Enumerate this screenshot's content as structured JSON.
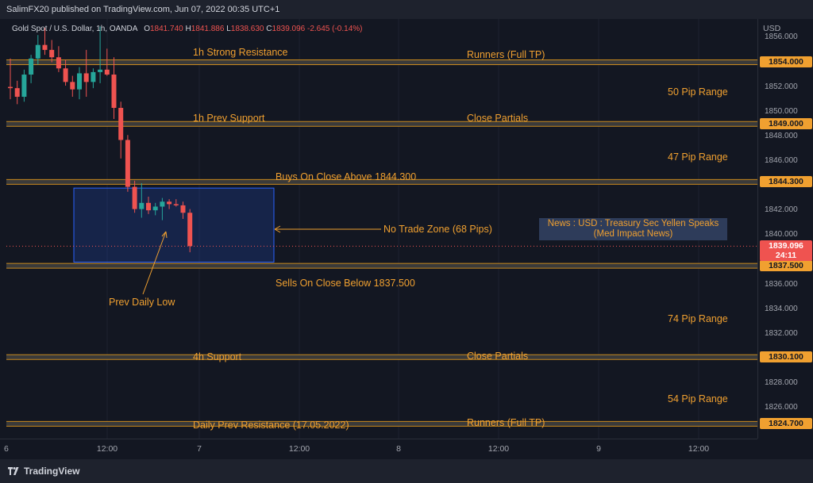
{
  "header": {
    "published_text": "SalimFX20 published on TradingView.com, Jun 07, 2022 00:35 UTC+1"
  },
  "legend": {
    "symbol": "Gold Spot / U.S. Dollar, 1h, OANDA",
    "open_label": "O",
    "open": "1841.740",
    "high_label": "H",
    "high": "1841.886",
    "low_label": "L",
    "low": "1838.630",
    "close_label": "C",
    "close": "1839.096",
    "change": "-2.645 (-0.14%)"
  },
  "annotations": {
    "strong_resistance": "1h Strong Resistance",
    "runners_top": "Runners (Full TP)",
    "range_50": "50 Pip Range",
    "prev_support": "1h Prev Support",
    "close_partials_top": "Close Partials",
    "range_47": "47 Pip Range",
    "buys_above": "Buys On Close Above 1844.300",
    "no_trade_zone": "No Trade Zone (68 Pips)",
    "news_line1": "News : USD : Treasury Sec Yellen Speaks",
    "news_line2": "(Med Impact News)",
    "sells_below": "Sells On Close Below 1837.500",
    "prev_daily_low": "Prev Daily Low",
    "range_74": "74 Pip Range",
    "support_4h": "4h Support",
    "close_partials_bottom": "Close Partials",
    "range_54": "54 Pip Range",
    "daily_prev_resistance": "Daily Prev Resistance (17.05.2022)",
    "runners_bottom": "Runners (Full TP)"
  },
  "price_axis": {
    "currency": "USD",
    "ticks": [
      "1856.000",
      "1852.000",
      "1850.000",
      "1848.000",
      "1846.000",
      "1842.000",
      "1840.000",
      "1836.000",
      "1834.000",
      "1832.000",
      "1828.000",
      "1826.000"
    ],
    "levels": [
      "1854.000",
      "1849.000",
      "1844.300",
      "1837.500",
      "1830.100",
      "1824.700"
    ],
    "current_price": "1839.096",
    "countdown": "24:11"
  },
  "time_axis": {
    "ticks": [
      "6",
      "12:00",
      "7",
      "12:00",
      "8",
      "12:00",
      "9",
      "12:00"
    ]
  },
  "footer": {
    "brand": "TradingView"
  },
  "colors": {
    "background": "#131722",
    "level": "#f0a030",
    "up": "#26a69a",
    "down": "#ef5350",
    "zone": "#2962ff"
  },
  "chart_data": {
    "type": "candlestick",
    "symbol": "Gold Spot / U.S. Dollar",
    "timeframe": "1h",
    "ylim": [
      1823.5,
      1857.5
    ],
    "level_lines": [
      1854.0,
      1849.0,
      1844.3,
      1837.5,
      1830.1,
      1824.7
    ],
    "current_price": 1839.096,
    "no_trade_zone": {
      "top": 1843.8,
      "bottom": 1837.8
    },
    "candles": [
      {
        "o": 1852.0,
        "h": 1854.3,
        "l": 1851.0,
        "c": 1851.9
      },
      {
        "o": 1851.9,
        "h": 1852.5,
        "l": 1850.6,
        "c": 1851.2
      },
      {
        "o": 1851.2,
        "h": 1853.4,
        "l": 1850.8,
        "c": 1853.0
      },
      {
        "o": 1853.0,
        "h": 1854.6,
        "l": 1852.3,
        "c": 1854.3
      },
      {
        "o": 1854.3,
        "h": 1856.2,
        "l": 1853.8,
        "c": 1855.4
      },
      {
        "o": 1855.4,
        "h": 1856.8,
        "l": 1854.6,
        "c": 1855.0
      },
      {
        "o": 1855.0,
        "h": 1855.8,
        "l": 1854.0,
        "c": 1854.4
      },
      {
        "o": 1854.4,
        "h": 1855.3,
        "l": 1853.2,
        "c": 1853.5
      },
      {
        "o": 1853.5,
        "h": 1854.2,
        "l": 1852.1,
        "c": 1852.4
      },
      {
        "o": 1852.4,
        "h": 1852.9,
        "l": 1851.2,
        "c": 1851.8
      },
      {
        "o": 1851.8,
        "h": 1853.6,
        "l": 1851.0,
        "c": 1853.1
      },
      {
        "o": 1853.1,
        "h": 1855.0,
        "l": 1851.2,
        "c": 1852.4
      },
      {
        "o": 1852.4,
        "h": 1853.5,
        "l": 1851.9,
        "c": 1853.2
      },
      {
        "o": 1853.2,
        "h": 1856.9,
        "l": 1852.3,
        "c": 1853.4
      },
      {
        "o": 1853.4,
        "h": 1855.1,
        "l": 1852.9,
        "c": 1853.0
      },
      {
        "o": 1853.0,
        "h": 1854.4,
        "l": 1849.4,
        "c": 1850.3
      },
      {
        "o": 1850.3,
        "h": 1850.8,
        "l": 1846.2,
        "c": 1847.7
      },
      {
        "o": 1847.7,
        "h": 1848.1,
        "l": 1843.5,
        "c": 1843.9
      },
      {
        "o": 1843.9,
        "h": 1844.4,
        "l": 1841.8,
        "c": 1842.1
      },
      {
        "o": 1842.1,
        "h": 1844.2,
        "l": 1841.4,
        "c": 1842.6
      },
      {
        "o": 1842.6,
        "h": 1843.1,
        "l": 1841.7,
        "c": 1842.0
      },
      {
        "o": 1842.0,
        "h": 1842.6,
        "l": 1841.6,
        "c": 1842.3
      },
      {
        "o": 1842.3,
        "h": 1843.0,
        "l": 1841.2,
        "c": 1842.7
      },
      {
        "o": 1842.7,
        "h": 1842.9,
        "l": 1842.1,
        "c": 1842.5
      },
      {
        "o": 1842.5,
        "h": 1842.9,
        "l": 1842.3,
        "c": 1842.4
      },
      {
        "o": 1842.4,
        "h": 1842.7,
        "l": 1841.3,
        "c": 1841.8
      },
      {
        "o": 1841.8,
        "h": 1842.1,
        "l": 1838.6,
        "c": 1839.1
      }
    ]
  }
}
